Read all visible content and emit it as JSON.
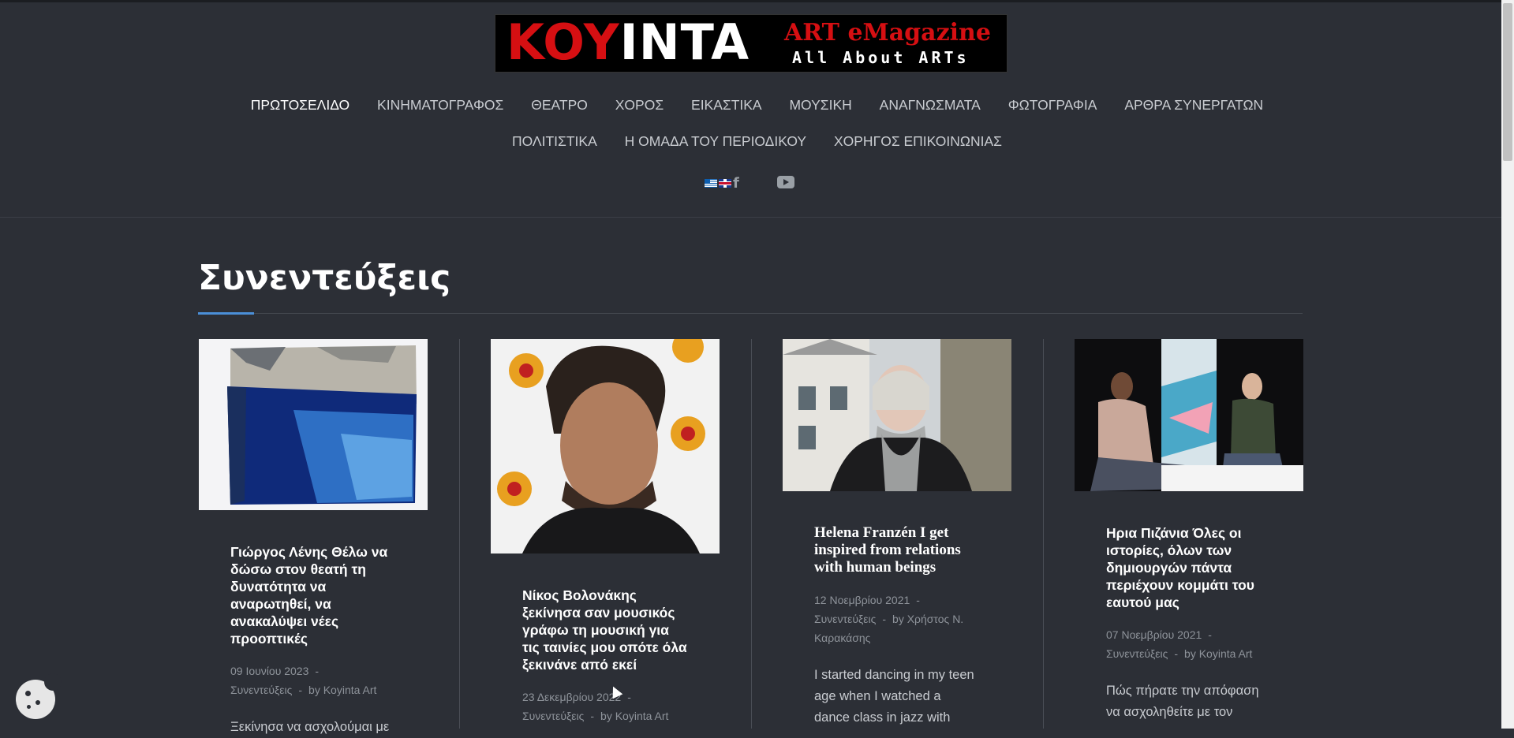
{
  "logo": {
    "koy": "KOY",
    "inta": "INTA",
    "art": "ART eMagazine",
    "tagline": "All About ARTs"
  },
  "nav": {
    "row1": [
      "ΠΡΩΤΟΣΕΛΙΔΟ",
      "ΚΙΝΗΜΑΤΟΓΡΑΦΟΣ",
      "ΘΕΑΤΡΟ",
      "ΧΟΡΟΣ",
      "ΕΙΚΑΣΤΙΚΑ",
      "ΜΟΥΣΙΚΗ",
      "ΑΝΑΓΝΩΣΜΑΤΑ",
      "ΦΩΤΟΓΡΑΦΙΑ",
      "ΑΡΘΡΑ ΣΥΝΕΡΓΑΤΩΝ"
    ],
    "row2": [
      "ΠΟΛΙΤΙΣΤΙΚΑ",
      "Η ΟΜΑΔΑ ΤΟΥ ΠΕΡΙΟΔΙΚΟΥ",
      "ΧΟΡΗΓΟΣ ΕΠΙΚΟΙΝΩΝΙΑΣ"
    ]
  },
  "social": {
    "facebook": "f",
    "icons": [
      "greek-flag-icon",
      "uk-flag-icon",
      "facebook-icon",
      "youtube-icon"
    ]
  },
  "page": {
    "title": "Συνεντεύξεις"
  },
  "colors": {
    "accent": "#4b8fd8",
    "background": "#2c2f36",
    "logo_red": "#d60f12"
  },
  "articles": [
    {
      "title": "Γιώργος Λένης Θέλω να δώσω στον θεατή τη δυνατότητα να αναρωτηθεί, να ανακαλύψει νέες προοπτικές",
      "date": "09 Ιουνίου 2023",
      "category": "Συνεντεύξεις",
      "author": "by Koyinta Art",
      "excerpt": "Ξεκίνησα να ασχολούμαι με"
    },
    {
      "title": "Νίκος Βολονάκης ξεκίνησα σαν μουσικός γράφω τη μουσική για τις ταινίες μου οπότε όλα ξεκινάνε από εκεί",
      "date": "23 Δεκεμβρίου 2022",
      "category": "Συνεντεύξεις",
      "author": "by Koyinta Art",
      "excerpt": ""
    },
    {
      "title": "Helena Franzén I get inspired from relations with human beings",
      "date": "12 Νοεμβρίου 2021",
      "category": "Συνεντεύξεις",
      "author": "by Χρήστος Ν. Καρακάσης",
      "excerpt": "I started dancing in my teen age when I watched a dance class in jazz with"
    },
    {
      "title": "Ηρια Πιζάνια Όλες οι ιστορίες, όλων των δημιουργών πάντα περιέχουν κομμάτι του εαυτού μας",
      "date": "07 Νοεμβρίου 2021",
      "category": "Συνεντεύξεις",
      "author": "by Koyinta Art",
      "excerpt": "Πώς πήρατε την απόφαση να ασχοληθείτε με τον"
    }
  ]
}
